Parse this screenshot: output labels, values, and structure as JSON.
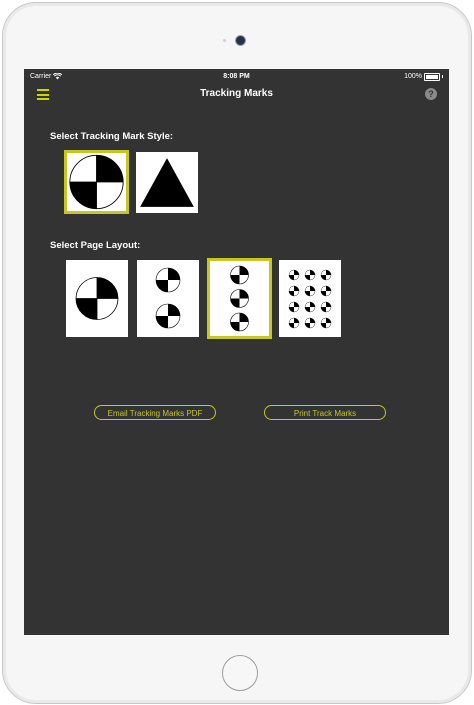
{
  "status_bar": {
    "carrier": "Carrier",
    "time": "8:08 PM",
    "battery": "100%"
  },
  "nav": {
    "title": "Tracking Marks",
    "menu_icon": "hamburger-menu-icon",
    "help_icon": "question-mark-icon",
    "help_glyph": "?"
  },
  "mark_style": {
    "label": "Select Tracking Mark Style:",
    "options": [
      {
        "name": "quartered-circle",
        "selected": true
      },
      {
        "name": "triangle",
        "selected": false
      }
    ]
  },
  "page_layout": {
    "label": "Select Page Layout:",
    "options": [
      {
        "name": "one-per-page",
        "marks": 1,
        "selected": false
      },
      {
        "name": "two-per-page",
        "marks": 2,
        "selected": false
      },
      {
        "name": "three-per-page",
        "marks": 3,
        "selected": true
      },
      {
        "name": "twelve-per-page",
        "marks": 12,
        "selected": false
      }
    ]
  },
  "actions": {
    "email_label": "Email Tracking Marks PDF",
    "print_label": "Print Track Marks"
  },
  "colors": {
    "accent": "#c7c624",
    "screen_bg": "#333333",
    "tile_bg": "#ffffff"
  }
}
